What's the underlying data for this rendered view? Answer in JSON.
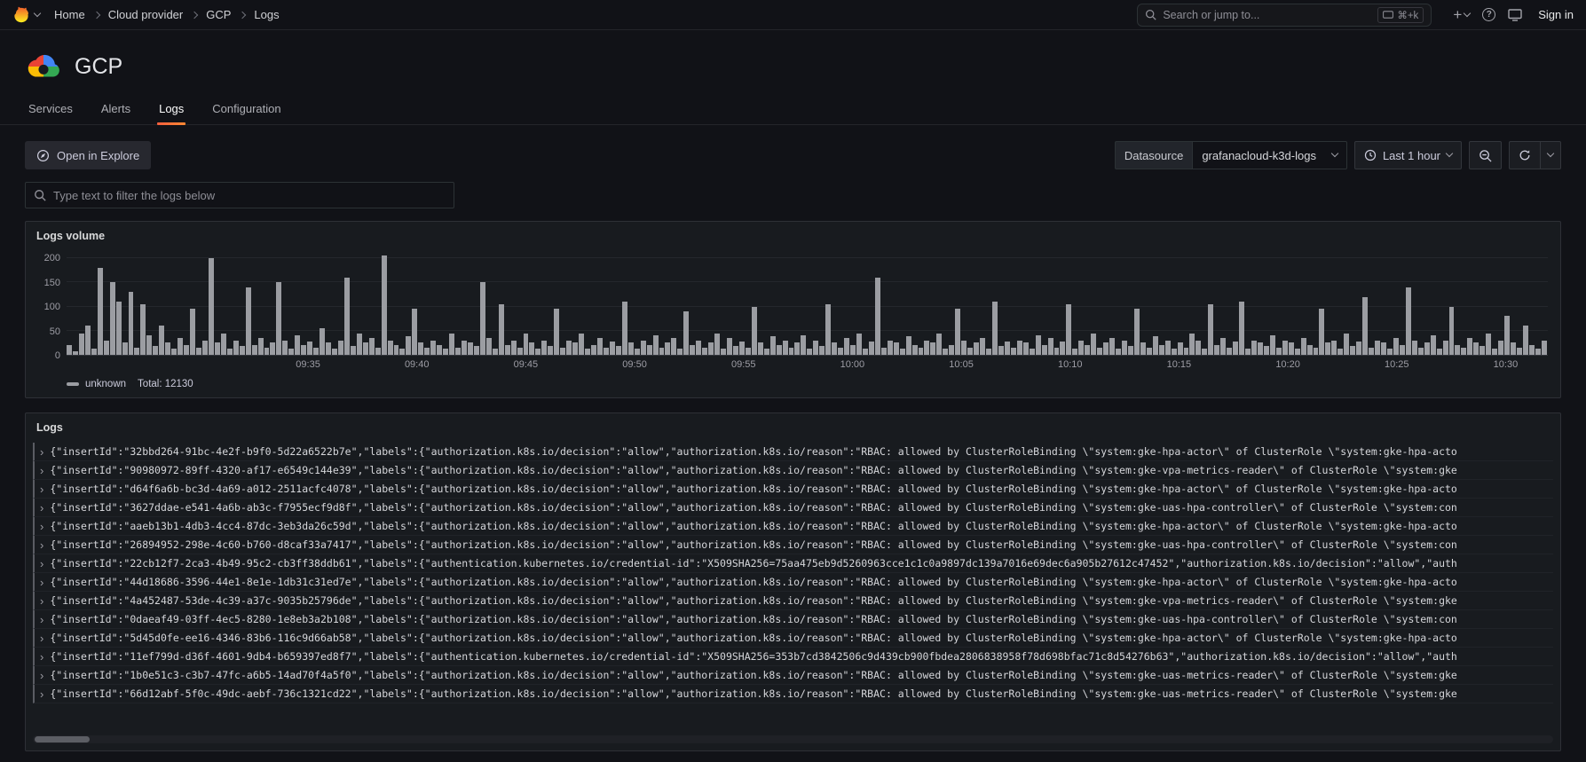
{
  "nav": {
    "breadcrumbs": [
      "Home",
      "Cloud provider",
      "GCP",
      "Logs"
    ],
    "search_placeholder": "Search or jump to...",
    "search_shortcut": "⌘+k",
    "sign_in_label": "Sign in"
  },
  "header": {
    "title": "GCP"
  },
  "tabs": {
    "items": [
      "Services",
      "Alerts",
      "Logs",
      "Configuration"
    ],
    "active": "Logs"
  },
  "toolbar": {
    "explore_button": "Open in Explore",
    "datasource_label": "Datasource",
    "datasource_value": "grafanacloud-k3d-logs",
    "time_range_label": "Last 1 hour"
  },
  "filter": {
    "placeholder": "Type text to filter the logs below"
  },
  "logs_volume": {
    "title": "Logs volume",
    "legend_series": "unknown",
    "legend_total": "Total: 12130",
    "chart_data": {
      "type": "bar",
      "title": "Logs volume",
      "xlabel": "",
      "ylabel": "",
      "x_ticks": [
        "09:35",
        "09:40",
        "09:45",
        "09:50",
        "09:55",
        "10:00",
        "10:05",
        "10:10",
        "10:15",
        "10:20",
        "10:25",
        "10:30"
      ],
      "y_ticks": [
        0,
        50,
        100,
        150,
        200
      ],
      "ylim": [
        0,
        215
      ],
      "grid": true,
      "legend_position": "bottom",
      "total": 12130,
      "series": [
        {
          "name": "unknown",
          "color": "#9B9DA2",
          "values": [
            20,
            8,
            45,
            60,
            12,
            180,
            30,
            150,
            110,
            25,
            130,
            15,
            105,
            40,
            18,
            60,
            25,
            12,
            35,
            20,
            95,
            15,
            30,
            200,
            25,
            45,
            12,
            30,
            18,
            140,
            20,
            35,
            15,
            25,
            150,
            30,
            12,
            40,
            20,
            28,
            15,
            55,
            25,
            12,
            30,
            160,
            18,
            45,
            25,
            35,
            15,
            205,
            30,
            20,
            12,
            38,
            95,
            25,
            15,
            30,
            20,
            12,
            45,
            15,
            30,
            25,
            18,
            150,
            35,
            12,
            105,
            20,
            30,
            15,
            45,
            25,
            12,
            30,
            18,
            95,
            15,
            30,
            25,
            45,
            12,
            20,
            35,
            15,
            28,
            18,
            110,
            25,
            12,
            30,
            20,
            40,
            15,
            25,
            35,
            12,
            90,
            20,
            30,
            15,
            25,
            45,
            12,
            35,
            18,
            28,
            15,
            100,
            25,
            12,
            38,
            20,
            30,
            15,
            25,
            40,
            12,
            30,
            18,
            105,
            25,
            15,
            35,
            20,
            45,
            12,
            28,
            160,
            15,
            30,
            25,
            12,
            38,
            20,
            15,
            30,
            25,
            45,
            12,
            20,
            95,
            30,
            15,
            25,
            35,
            12,
            110,
            18,
            28,
            15,
            30,
            25,
            12,
            40,
            20,
            35,
            15,
            28,
            105,
            12,
            30,
            20,
            45,
            15,
            25,
            35,
            12,
            30,
            18,
            95,
            25,
            15,
            38,
            20,
            30,
            12,
            25,
            15,
            45,
            30,
            12,
            105,
            20,
            35,
            15,
            28,
            110,
            12,
            30,
            25,
            18,
            40,
            15,
            30,
            25,
            12,
            35,
            20,
            15,
            95,
            25,
            30,
            12,
            45,
            18,
            28,
            120,
            15,
            30,
            25,
            12,
            35,
            20,
            140,
            30,
            15,
            25,
            40,
            12,
            30,
            100,
            20,
            15,
            35,
            25,
            18,
            45,
            12,
            30,
            80,
            25,
            15,
            60,
            20,
            12,
            30
          ]
        }
      ]
    }
  },
  "logs": {
    "title": "Logs",
    "rows": [
      "{\"insertId\":\"32bbd264-91bc-4e2f-b9f0-5d22a6522b7e\",\"labels\":{\"authorization.k8s.io/decision\":\"allow\",\"authorization.k8s.io/reason\":\"RBAC: allowed by ClusterRoleBinding \\\"system:gke-hpa-actor\\\" of ClusterRole \\\"system:gke-hpa-acto",
      "{\"insertId\":\"90980972-89ff-4320-af17-e6549c144e39\",\"labels\":{\"authorization.k8s.io/decision\":\"allow\",\"authorization.k8s.io/reason\":\"RBAC: allowed by ClusterRoleBinding \\\"system:gke-vpa-metrics-reader\\\" of ClusterRole \\\"system:gke",
      "{\"insertId\":\"d64f6a6b-bc3d-4a69-a012-2511acfc4078\",\"labels\":{\"authorization.k8s.io/decision\":\"allow\",\"authorization.k8s.io/reason\":\"RBAC: allowed by ClusterRoleBinding \\\"system:gke-hpa-actor\\\" of ClusterRole \\\"system:gke-hpa-acto",
      "{\"insertId\":\"3627ddae-e541-4a6b-ab3c-f7955ecf9d8f\",\"labels\":{\"authorization.k8s.io/decision\":\"allow\",\"authorization.k8s.io/reason\":\"RBAC: allowed by ClusterRoleBinding \\\"system:gke-uas-hpa-controller\\\" of ClusterRole \\\"system:con",
      "{\"insertId\":\"aaeb13b1-4db3-4cc4-87dc-3eb3da26c59d\",\"labels\":{\"authorization.k8s.io/decision\":\"allow\",\"authorization.k8s.io/reason\":\"RBAC: allowed by ClusterRoleBinding \\\"system:gke-hpa-actor\\\" of ClusterRole \\\"system:gke-hpa-acto",
      "{\"insertId\":\"26894952-298e-4c60-b760-d8caf33a7417\",\"labels\":{\"authorization.k8s.io/decision\":\"allow\",\"authorization.k8s.io/reason\":\"RBAC: allowed by ClusterRoleBinding \\\"system:gke-uas-hpa-controller\\\" of ClusterRole \\\"system:con",
      "{\"insertId\":\"22cb12f7-2ca3-4b49-95c2-cb3ff38ddb61\",\"labels\":{\"authentication.kubernetes.io/credential-id\":\"X509SHA256=75aa475eb9d5260963cce1c1c0a9897dc139a7016e69dec6a905b27612c47452\",\"authorization.k8s.io/decision\":\"allow\",\"auth",
      "{\"insertId\":\"44d18686-3596-44e1-8e1e-1db31c31ed7e\",\"labels\":{\"authorization.k8s.io/decision\":\"allow\",\"authorization.k8s.io/reason\":\"RBAC: allowed by ClusterRoleBinding \\\"system:gke-hpa-actor\\\" of ClusterRole \\\"system:gke-hpa-acto",
      "{\"insertId\":\"4a452487-53de-4c39-a37c-9035b25796de\",\"labels\":{\"authorization.k8s.io/decision\":\"allow\",\"authorization.k8s.io/reason\":\"RBAC: allowed by ClusterRoleBinding \\\"system:gke-vpa-metrics-reader\\\" of ClusterRole \\\"system:gke",
      "{\"insertId\":\"0daeaf49-03ff-4ec5-8280-1e8eb3a2b108\",\"labels\":{\"authorization.k8s.io/decision\":\"allow\",\"authorization.k8s.io/reason\":\"RBAC: allowed by ClusterRoleBinding \\\"system:gke-uas-hpa-controller\\\" of ClusterRole \\\"system:con",
      "{\"insertId\":\"5d45d0fe-ee16-4346-83b6-116c9d66ab58\",\"labels\":{\"authorization.k8s.io/decision\":\"allow\",\"authorization.k8s.io/reason\":\"RBAC: allowed by ClusterRoleBinding \\\"system:gke-hpa-actor\\\" of ClusterRole \\\"system:gke-hpa-acto",
      "{\"insertId\":\"11ef799d-d36f-4601-9db4-b659397ed8f7\",\"labels\":{\"authentication.kubernetes.io/credential-id\":\"X509SHA256=353b7cd3842506c9d439cb900fbdea2806838958f78d698bfac71c8d54276b63\",\"authorization.k8s.io/decision\":\"allow\",\"auth",
      "{\"insertId\":\"1b0e51c3-c3b7-47fc-a6b5-14ad70f4a5f0\",\"labels\":{\"authorization.k8s.io/decision\":\"allow\",\"authorization.k8s.io/reason\":\"RBAC: allowed by ClusterRoleBinding \\\"system:gke-uas-metrics-reader\\\" of ClusterRole \\\"system:gke",
      "{\"insertId\":\"66d12abf-5f0c-49dc-aebf-736c1321cd22\",\"labels\":{\"authorization.k8s.io/decision\":\"allow\",\"authorization.k8s.io/reason\":\"RBAC: allowed by ClusterRoleBinding \\\"system:gke-uas-metrics-reader\\\" of ClusterRole \\\"system:gke"
    ]
  },
  "colors": {
    "accent_orange": "#FF8833",
    "bar_gray": "#9B9DA2",
    "panel_bg": "#181B1F",
    "canvas_bg": "#111217"
  }
}
